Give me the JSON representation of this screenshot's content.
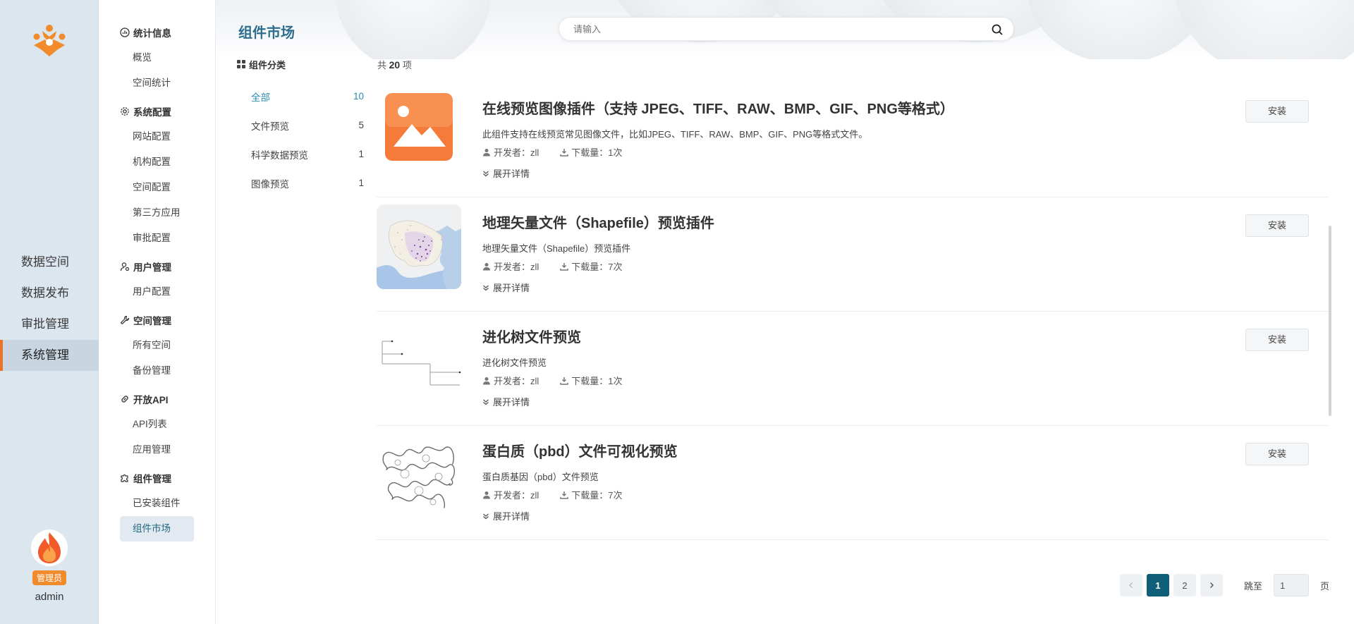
{
  "rail": {
    "nav": [
      {
        "label": "数据空间"
      },
      {
        "label": "数据发布"
      },
      {
        "label": "审批管理"
      },
      {
        "label": "系统管理",
        "active": true
      }
    ],
    "user": {
      "role_badge": "管理员",
      "name": "admin"
    }
  },
  "menu": {
    "groups": [
      {
        "title": "统计信息",
        "icon": "chart-icon",
        "items": [
          "概览",
          "空间统计"
        ]
      },
      {
        "title": "系统配置",
        "icon": "gear-icon",
        "items": [
          "网站配置",
          "机构配置",
          "空间配置",
          "第三方应用",
          "审批配置"
        ]
      },
      {
        "title": "用户管理",
        "icon": "user-gear-icon",
        "items": [
          "用户配置"
        ]
      },
      {
        "title": "空间管理",
        "icon": "wrench-icon",
        "items": [
          "所有空间",
          "备份管理"
        ]
      },
      {
        "title": "开放API",
        "icon": "link-icon",
        "items": [
          "API列表",
          "应用管理"
        ]
      },
      {
        "title": "组件管理",
        "icon": "puzzle-icon",
        "items": [
          "已安装组件",
          "组件市场"
        ],
        "active_item": "组件市场"
      }
    ]
  },
  "header": {
    "title": "组件市场",
    "search_placeholder": "请输入"
  },
  "categories": {
    "title": "组件分类",
    "items": [
      {
        "label": "全部",
        "count": "10",
        "active": true
      },
      {
        "label": "文件预览",
        "count": "5"
      },
      {
        "label": "科学数据预览",
        "count": "1"
      },
      {
        "label": "图像预览",
        "count": "1"
      }
    ]
  },
  "total": {
    "prefix": "共",
    "count": "20",
    "suffix": "项"
  },
  "plugins": [
    {
      "title": "在线预览图像插件（支持 JPEG、TIFF、RAW、BMP、GIF、PNG等格式）",
      "description": "此组件支持在线预览常见图像文件，比如JPEG、TIFF、RAW、BMP、GIF、PNG等格式文件。",
      "developer": "开发者：zll",
      "downloads": "下载量：1次",
      "expand": "展开详情",
      "install": "安装",
      "thumb": "image-icon-thumb"
    },
    {
      "title": "地理矢量文件（Shapefile）预览插件",
      "description": "地理矢量文件（Shapefile）预览插件",
      "developer": "开发者：zll",
      "downloads": "下载量：7次",
      "expand": "展开详情",
      "install": "安装",
      "thumb": "map-thumb"
    },
    {
      "title": "进化树文件预览",
      "description": "进化树文件预览",
      "developer": "开发者：zll",
      "downloads": "下载量：1次",
      "expand": "展开详情",
      "install": "安装",
      "thumb": "tree-thumb"
    },
    {
      "title": "蛋白质（pbd）文件可视化预览",
      "description": "蛋白质基因（pbd）文件预览",
      "developer": "开发者：zll",
      "downloads": "下载量：7次",
      "expand": "展开详情",
      "install": "安装",
      "thumb": "protein-thumb"
    }
  ],
  "pagination": {
    "pages": [
      "1",
      "2"
    ],
    "current": "1",
    "jump_label": "跳至",
    "jump_value": "1",
    "page_unit": "页"
  },
  "colors": {
    "accent": "#f28b2c",
    "primary": "#0f5f78",
    "title_blue": "#2e6f8e",
    "active_link": "#2a8ab0"
  }
}
